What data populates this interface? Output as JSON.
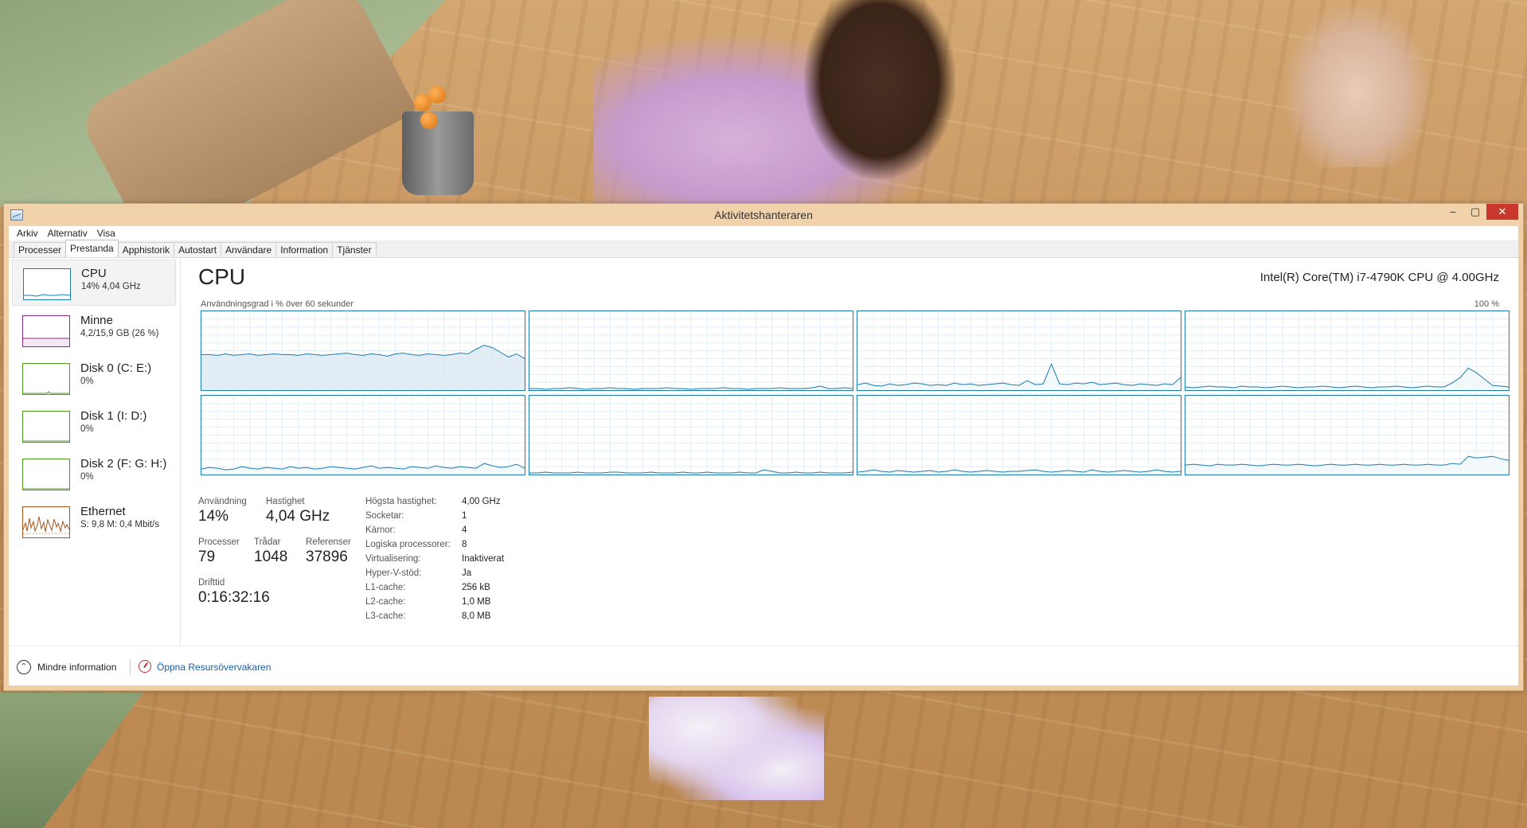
{
  "window": {
    "title": "Aktivitetshanteraren",
    "min_glyph": "–",
    "max_glyph": "▢",
    "close_glyph": "✕"
  },
  "menu": [
    "Arkiv",
    "Alternativ",
    "Visa"
  ],
  "tabs": [
    {
      "label": "Processer",
      "active": false
    },
    {
      "label": "Prestanda",
      "active": true
    },
    {
      "label": "Apphistorik",
      "active": false
    },
    {
      "label": "Autostart",
      "active": false
    },
    {
      "label": "Användare",
      "active": false
    },
    {
      "label": "Information",
      "active": false
    },
    {
      "label": "Tjänster",
      "active": false
    }
  ],
  "sidebar": {
    "items": [
      {
        "title": "CPU",
        "sub": "14% 4,04 GHz",
        "color": "#1a7bb0",
        "selected": true
      },
      {
        "title": "Minne",
        "sub": "4,2/15,9 GB (26 %)",
        "color": "#8b2c8b",
        "selected": false
      },
      {
        "title": "Disk 0 (C: E:)",
        "sub": "0%",
        "color": "#4d9a1e",
        "selected": false
      },
      {
        "title": "Disk 1 (I: D:)",
        "sub": "0%",
        "color": "#4d9a1e",
        "selected": false
      },
      {
        "title": "Disk 2 (F: G: H:)",
        "sub": "0%",
        "color": "#4d9a1e",
        "selected": false
      },
      {
        "title": "Ethernet",
        "sub": "S: 9,8 M: 0,4 Mbit/s",
        "color": "#a6531b",
        "selected": false
      }
    ]
  },
  "main": {
    "title": "CPU",
    "model": "Intel(R) Core(TM) i7-4790K CPU @ 4.00GHz",
    "graph_caption": "Användningsgrad i % över 60 sekunder",
    "graph_max": "100 %",
    "accent": "#1a7bb0"
  },
  "core_graphs": [
    {
      "samples": [
        45,
        45,
        44,
        46,
        44,
        45,
        46,
        44,
        45,
        46,
        45,
        45,
        44,
        46,
        45,
        44,
        45,
        46,
        47,
        45,
        44,
        46,
        45,
        43,
        46,
        47,
        45,
        44,
        46,
        45,
        44,
        45,
        47,
        46,
        52,
        57,
        54,
        48,
        42,
        46,
        40
      ],
      "filled": true
    },
    {
      "samples": [
        2,
        2,
        1,
        2,
        2,
        3,
        2,
        1,
        2,
        2,
        3,
        2,
        2,
        1,
        2,
        2,
        2,
        3,
        2,
        2,
        1,
        2,
        2,
        2,
        3,
        2,
        2,
        1,
        2,
        2,
        2,
        3,
        2,
        2,
        2,
        3,
        5,
        2,
        2,
        3,
        2
      ]
    },
    {
      "samples": [
        7,
        9,
        6,
        5,
        8,
        6,
        7,
        9,
        8,
        6,
        7,
        6,
        9,
        7,
        8,
        6,
        7,
        8,
        9,
        7,
        6,
        12,
        7,
        8,
        33,
        8,
        7,
        9,
        8,
        10,
        7,
        8,
        9,
        7,
        6,
        8,
        7,
        6,
        8,
        7,
        16
      ]
    },
    {
      "samples": [
        4,
        3,
        4,
        5,
        4,
        4,
        3,
        5,
        4,
        4,
        3,
        4,
        5,
        4,
        3,
        4,
        4,
        5,
        4,
        3,
        4,
        5,
        4,
        3,
        4,
        4,
        5,
        4,
        3,
        4,
        5,
        4,
        4,
        9,
        16,
        28,
        22,
        14,
        6,
        5,
        4
      ]
    },
    {
      "samples": [
        7,
        9,
        8,
        6,
        7,
        10,
        8,
        7,
        9,
        8,
        7,
        10,
        8,
        9,
        7,
        8,
        10,
        9,
        8,
        7,
        9,
        11,
        8,
        9,
        8,
        7,
        10,
        9,
        8,
        11,
        9,
        8,
        10,
        9,
        8,
        14,
        11,
        9,
        10,
        13,
        8
      ]
    },
    {
      "samples": [
        2,
        2,
        3,
        2,
        2,
        2,
        3,
        2,
        2,
        2,
        3,
        3,
        2,
        2,
        2,
        3,
        2,
        2,
        2,
        3,
        2,
        2,
        3,
        2,
        2,
        2,
        3,
        2,
        2,
        6,
        4,
        2,
        2,
        3,
        2,
        2,
        3,
        2,
        2,
        2,
        3
      ]
    },
    {
      "samples": [
        3,
        4,
        6,
        4,
        3,
        5,
        4,
        3,
        4,
        5,
        3,
        4,
        6,
        4,
        3,
        4,
        5,
        4,
        3,
        4,
        4,
        5,
        6,
        4,
        3,
        4,
        5,
        4,
        3,
        6,
        4,
        3,
        4,
        5,
        4,
        3,
        4,
        6,
        4,
        3,
        4
      ]
    },
    {
      "samples": [
        12,
        13,
        12,
        11,
        13,
        12,
        12,
        13,
        12,
        11,
        12,
        13,
        12,
        12,
        13,
        12,
        11,
        12,
        13,
        12,
        12,
        13,
        12,
        12,
        13,
        12,
        12,
        13,
        12,
        12,
        13,
        12,
        12,
        14,
        13,
        23,
        21,
        22,
        23,
        20,
        18
      ]
    }
  ],
  "stats": {
    "usage_label": "Användning",
    "usage": "14%",
    "speed_label": "Hastighet",
    "speed": "4,04 GHz",
    "processes_label": "Processer",
    "processes": "79",
    "threads_label": "Trådar",
    "threads": "1048",
    "handles_label": "Referenser",
    "handles": "37896",
    "uptime_label": "Drifttid",
    "uptime": "0:16:32:16"
  },
  "specs": [
    {
      "key": "Högsta hastighet:",
      "value": "4,00 GHz"
    },
    {
      "key": "Socketar:",
      "value": "1"
    },
    {
      "key": "Kärnor:",
      "value": "4"
    },
    {
      "key": "Logiska processorer:",
      "value": "8"
    },
    {
      "key": "Virtualisering:",
      "value": "Inaktiverat"
    },
    {
      "key": "Hyper-V-stöd:",
      "value": "Ja"
    },
    {
      "key": "L1-cache:",
      "value": "256 kB"
    },
    {
      "key": "L2-cache:",
      "value": "1,0 MB"
    },
    {
      "key": "L3-cache:",
      "value": "8,0 MB"
    }
  ],
  "footer": {
    "fewer_details": "Mindre information",
    "open_resmon": "Öppna Resursövervakaren",
    "chevron_glyph": "⌃"
  }
}
